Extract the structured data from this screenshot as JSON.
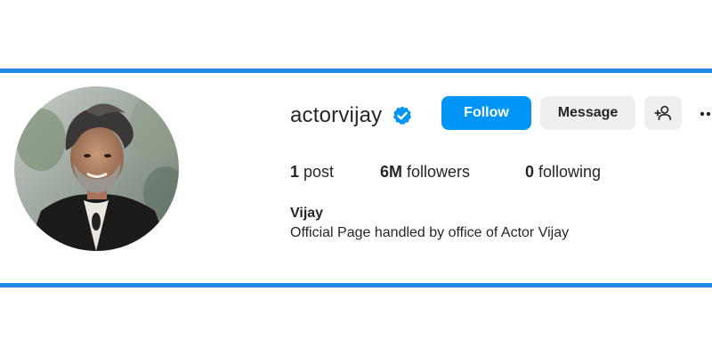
{
  "profile": {
    "username": "actorvijay",
    "verified": true,
    "full_name": "Vijay",
    "bio": "Official Page handled by office of Actor Vijay",
    "avatar_icon": "profile-photo"
  },
  "actions": {
    "follow_label": "Follow",
    "message_label": "Message",
    "suggest_icon": "add-person-icon",
    "more_icon": "more-options-icon"
  },
  "stats": {
    "posts_count": "1",
    "posts_label": " post",
    "followers_count": "6M",
    "followers_label": " followers",
    "following_count": "0",
    "following_label": " following"
  },
  "colors": {
    "accent_rule": "#1d8ce3",
    "follow_button": "#0095f6",
    "secondary_button": "#efefef",
    "verified_badge": "#0095f6"
  }
}
